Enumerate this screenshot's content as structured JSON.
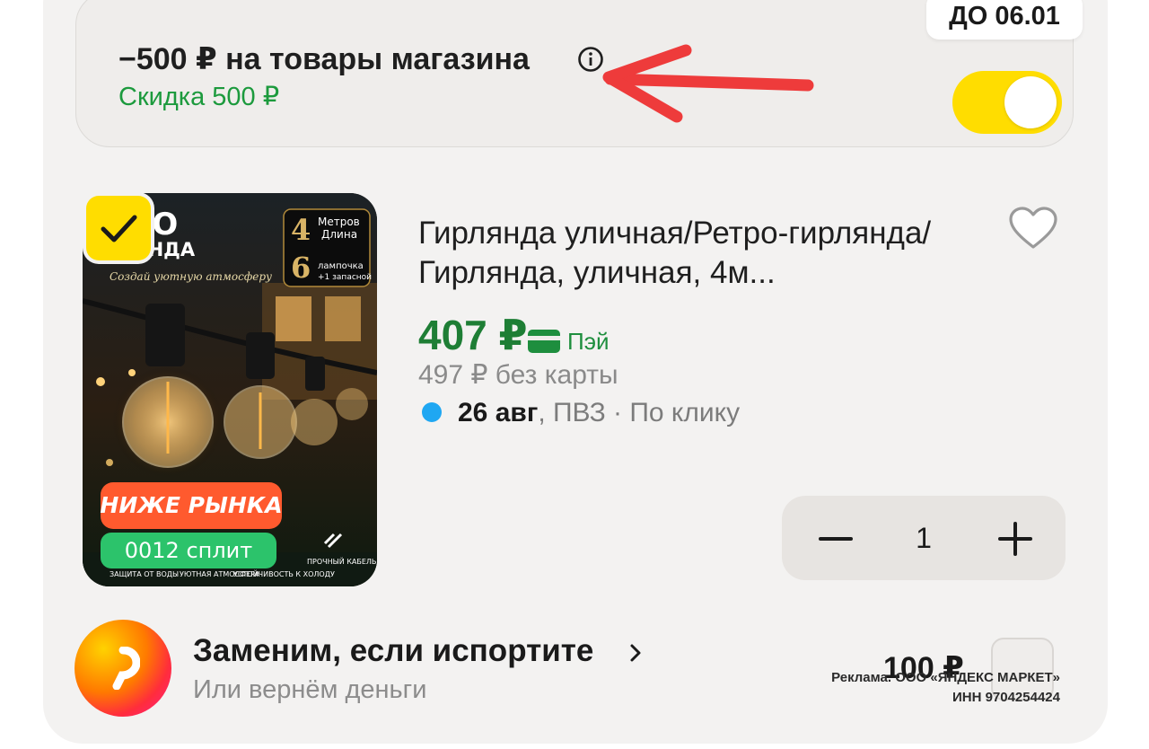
{
  "promo": {
    "title": "−500 ₽ на товары магазина",
    "subtitle": "Скидка 500 ₽",
    "deadline": "ДО 06.01",
    "toggle_on": true
  },
  "product": {
    "image_texts": {
      "title_line1": "ЕТРО",
      "title_line2": "ИРЛЯНДА",
      "tagline": "Создай уютную атмосферу",
      "length_num": "4",
      "length_l1": "Метров",
      "length_l2": "Длина",
      "bulbs_num": "6",
      "bulbs_l1": "лампочка",
      "bulbs_l2": "+1 запасной",
      "badge_market": "НИЖЕ РЫНКА",
      "split_badge": "0012 сплит",
      "features": [
        "ЗАЩИТА ОТ ВОДЫ",
        "УЮТНАЯ АТМОСФЕРА",
        "УСТОЙЧИВОСТЬ К ХОЛОДУ",
        "ПРОЧНЫЙ КАБЕЛЬ И НАДЕЖНЫЕ ПАТРОНЫ"
      ]
    },
    "selected": true,
    "title": "Гирлянда уличная/Ретро-гирлянда/Гирлянда, уличная, 4м...",
    "price": "407 ₽",
    "pay_label": "Пэй",
    "old_price": "497 ₽  без карты",
    "delivery_date": "26 авг",
    "delivery_rest": ", ПВЗ · По клику",
    "quantity": "1"
  },
  "protection": {
    "title": "Заменим, если испортите",
    "subtitle": "Или вернём деньги",
    "price": "100 ₽",
    "ad_line1": "Реклама. ООО «ЯНДЕКС МАРКЕТ»",
    "ad_line2": "ИНН 9704254424"
  },
  "colors": {
    "accent_yellow": "#ffdd00",
    "price_green": "#1e7e35",
    "delivery_dot": "#1fa7f2",
    "annotation_arrow": "#ee3b3b"
  }
}
